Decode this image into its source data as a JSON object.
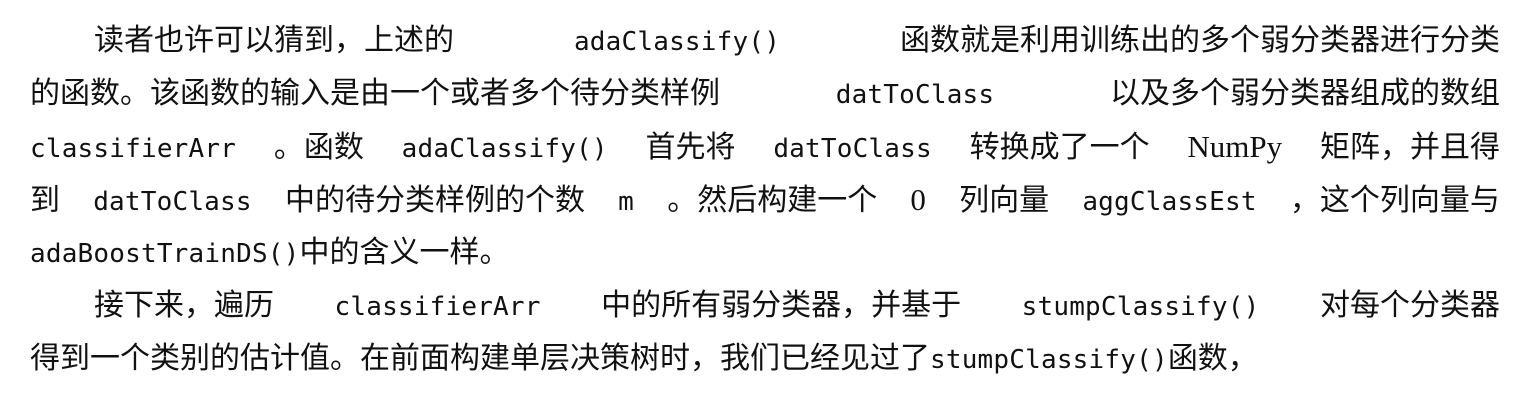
{
  "paragraphs": [
    {
      "lines": [
        [
          {
            "t": "text",
            "v": "读者也许可以猜到，上述的"
          },
          {
            "t": "code",
            "v": "adaClassify()"
          },
          {
            "t": "text",
            "v": "函数就是利用训练出的多个弱分类器进行分类"
          }
        ],
        [
          {
            "t": "text",
            "v": "的函数。该函数的输入是由一个或者多个待分类样例"
          },
          {
            "t": "code",
            "v": "datToClass"
          },
          {
            "t": "text",
            "v": "以及多个弱分类器组成的数组"
          }
        ],
        [
          {
            "t": "code",
            "v": "classifierArr"
          },
          {
            "t": "text",
            "v": "。函数"
          },
          {
            "t": "code",
            "v": "adaClassify()"
          },
          {
            "t": "text",
            "v": "首先将"
          },
          {
            "t": "code",
            "v": "datToClass"
          },
          {
            "t": "text",
            "v": "转换成了一个"
          },
          {
            "t": "latin",
            "v": "NumPy"
          },
          {
            "t": "text",
            "v": "矩阵，并且得"
          }
        ],
        [
          {
            "t": "text",
            "v": "到"
          },
          {
            "t": "code",
            "v": "datToClass"
          },
          {
            "t": "text",
            "v": "中的待分类样例的个数"
          },
          {
            "t": "code",
            "v": "m"
          },
          {
            "t": "text",
            "v": "。然后构建一个"
          },
          {
            "t": "latin",
            "v": "0"
          },
          {
            "t": "text",
            "v": "列向量"
          },
          {
            "t": "code",
            "v": "aggClassEst"
          },
          {
            "t": "text",
            "v": "，这个列向量与"
          }
        ],
        [
          {
            "t": "code",
            "v": "adaBoostTrainDS()"
          },
          {
            "t": "text",
            "v": "中的含义一样。"
          }
        ]
      ]
    },
    {
      "lines": [
        [
          {
            "t": "text",
            "v": "接下来，遍历"
          },
          {
            "t": "code",
            "v": "classifierArr"
          },
          {
            "t": "text",
            "v": "中的所有弱分类器，并基于"
          },
          {
            "t": "code",
            "v": "stumpClassify()"
          },
          {
            "t": "text",
            "v": "对每个分类器"
          }
        ],
        [
          {
            "t": "text",
            "v": "得到一个类别的估计值。在前面构建单层决策树时，我们已经见过了"
          },
          {
            "t": "code",
            "v": "stumpClassify()"
          },
          {
            "t": "text",
            "v": "函数，"
          }
        ]
      ]
    }
  ]
}
